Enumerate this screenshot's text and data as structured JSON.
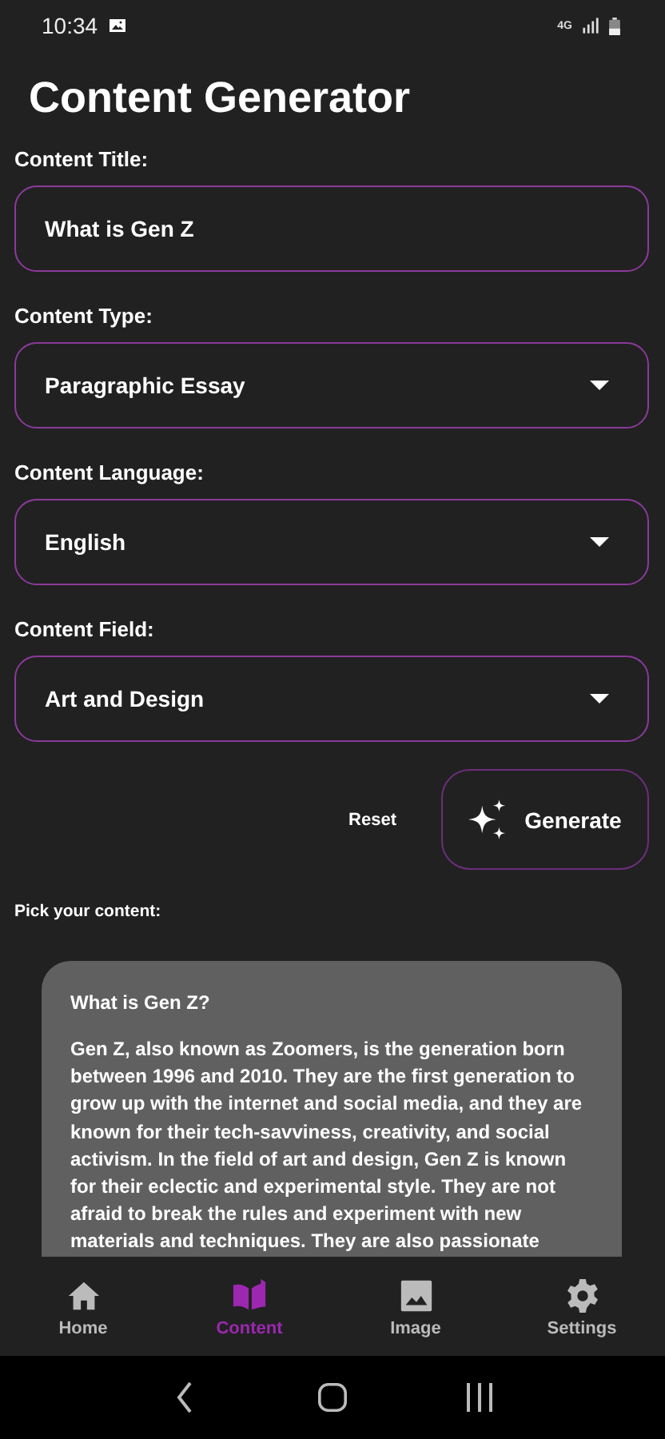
{
  "status_bar": {
    "time": "10:34",
    "network": "4G"
  },
  "title": "Content Generator",
  "fields": [
    {
      "kind": "text",
      "label": "Content Title:",
      "value": "What is Gen Z"
    },
    {
      "kind": "dropdown",
      "label": "Content Type:",
      "value": "Paragraphic Essay"
    },
    {
      "kind": "dropdown",
      "label": "Content Language:",
      "value": "English"
    },
    {
      "kind": "dropdown",
      "label": "Content Field:",
      "value": "Art and Design"
    }
  ],
  "actions": {
    "reset": "Reset",
    "generate": "Generate"
  },
  "pick_label": "Pick your content:",
  "content_card": {
    "title": "What is Gen Z?",
    "body": "Gen Z, also known as Zoomers, is the generation born between 1996 and 2010. They are the first generation to grow up with the internet and social media, and they are known for their tech-savviness, creativity, and social activism. In the field of art and design, Gen Z is known for their eclectic and experimental style. They are not afraid to break the rules and experiment with new materials and techniques. They are also passionate"
  },
  "nav": [
    {
      "kind": "home",
      "label": "Home",
      "selected": false
    },
    {
      "kind": "content",
      "label": "Content",
      "selected": true
    },
    {
      "kind": "image",
      "label": "Image",
      "selected": false
    },
    {
      "kind": "settings",
      "label": "Settings",
      "selected": false
    }
  ]
}
